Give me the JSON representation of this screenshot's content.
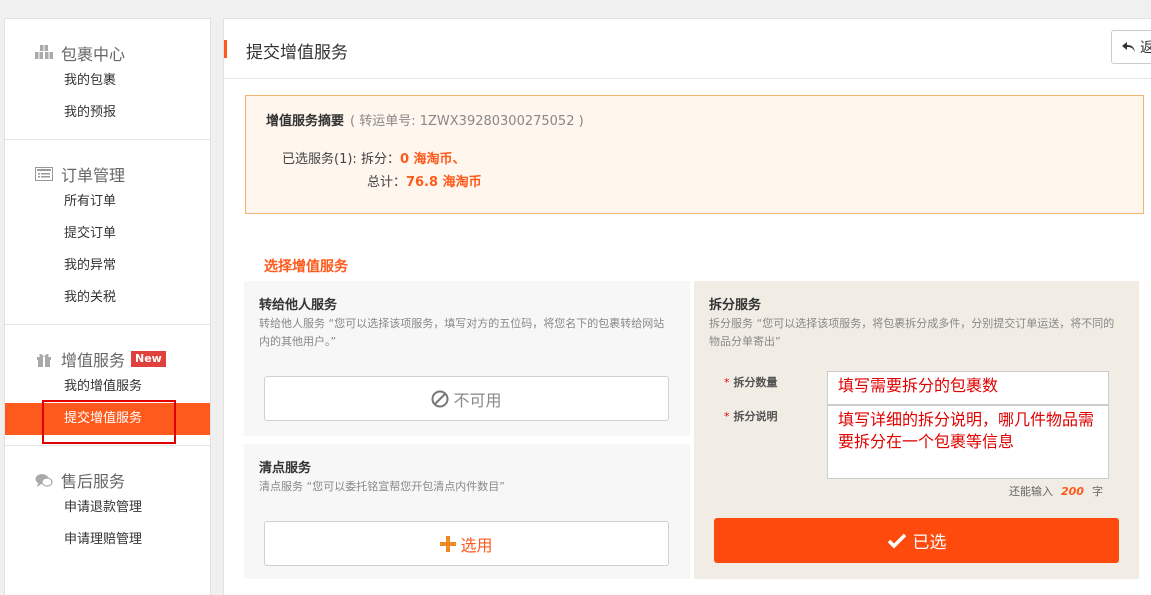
{
  "sidebar": {
    "sections": [
      {
        "title": "包裹中心",
        "icon": "packages-icon",
        "items": [
          "我的包裹",
          "我的预报"
        ]
      },
      {
        "title": "订单管理",
        "icon": "list-icon",
        "items": [
          "所有订单",
          "提交订单",
          "我的异常",
          "我的关税"
        ]
      },
      {
        "title": "增值服务",
        "icon": "gift-icon",
        "badge": "New",
        "items": [
          "我的增值服务",
          "提交增值服务"
        ]
      },
      {
        "title": "售后服务",
        "icon": "chat-icon",
        "items": [
          "申请退款管理",
          "申请理赔管理"
        ]
      }
    ],
    "active_item": "提交增值服务"
  },
  "header": {
    "title": "提交增值服务",
    "back_label": "返"
  },
  "summary": {
    "title": "增值服务摘要",
    "transfer_no": "( 转运单号: 1ZWX39280300275052 )",
    "selected_label": "已选服务(1):",
    "service_name": "拆分：",
    "service_cost": "0 海淘币、",
    "total_label": "总计：",
    "total_cost": "76.8 海淘币"
  },
  "section_title": "选择增值服务",
  "services": {
    "transfer": {
      "title": "转给他人服务",
      "desc": "转给他人服务 “您可以选择该项服务，填写对方的五位码，将您名下的包裹转给网站内的其他用户。”",
      "button": "不可用"
    },
    "split": {
      "title": "拆分服务",
      "desc": "拆分服务 “您可以选择该项服务，将包裹拆分成多件，分别提交订单运送，将不同的物品分单寄出”",
      "qty_label": "拆分数量",
      "qty_value": "填写需要拆分的包裹数",
      "note_label": "拆分说明",
      "note_value": "填写详细的拆分说明，哪几件物品需要拆分在一个包裹等信息",
      "remaining_prefix": "还能输入",
      "remaining_count": "200",
      "remaining_suffix": "字",
      "button": "已选"
    },
    "count": {
      "title": "清点服务",
      "desc": "清点服务 “您可以委托铭宣帮您开包清点内件数目”",
      "button": "选用"
    }
  },
  "colors": {
    "accent": "#fe5a1d",
    "highlight_box": "#e00000",
    "summary_bg": "#fff6ed",
    "summary_border": "#f1b572"
  }
}
